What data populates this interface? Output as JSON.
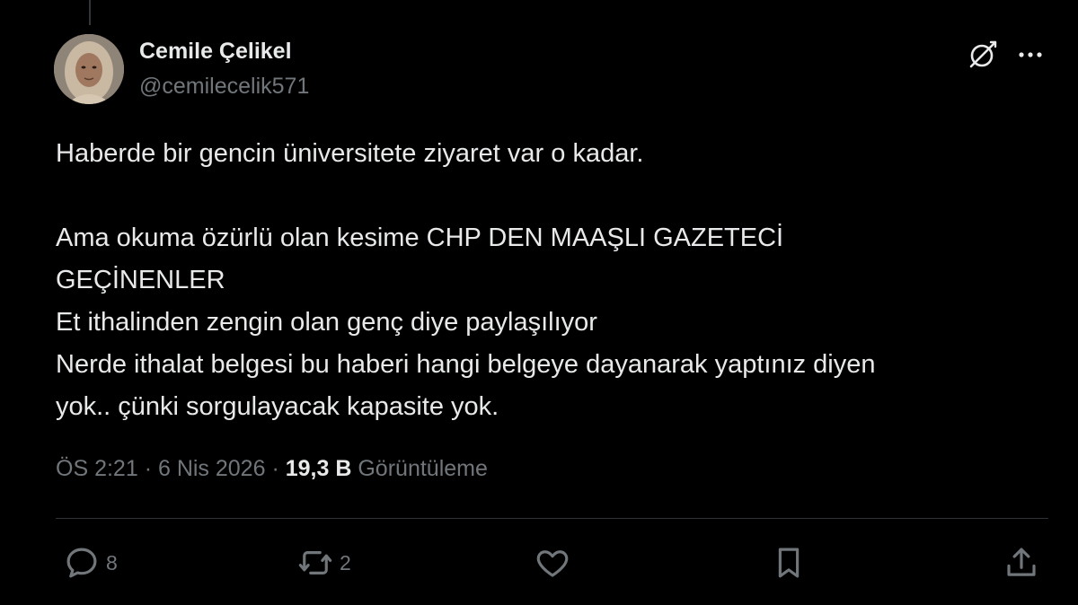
{
  "author": {
    "name": "Cemile Çelikel",
    "handle": "@cemilecelik571"
  },
  "tweet": {
    "lines_p1": [
      "Haberde bir gencin üniversitete ziyaret var o kadar."
    ],
    "lines_p2": [
      "Ama okuma özürlü olan kesime CHP DEN MAAŞLI GAZETECİ",
      "GEÇİNENLER",
      "Et ithalinden zengin olan genç diye paylaşılıyor",
      "Nerde ithalat belgesi bu haberi hangi belgeye dayanarak yaptınız diyen",
      "yok.. çünki  sorgulayacak kapasite yok."
    ]
  },
  "meta": {
    "time": "ÖS 2:21",
    "separator": "·",
    "date": "6 Nis 2026",
    "views_count": "19,3 B",
    "views_label": "Görüntüleme"
  },
  "actions": {
    "reply_count": "8",
    "retweet_count": "2"
  },
  "icons": {
    "thread": "thread-line",
    "grok": "grok-icon",
    "more": "more-dots-icon",
    "reply": "reply-bubble-icon",
    "retweet": "retweet-icon",
    "like": "heart-icon",
    "bookmark": "bookmark-icon",
    "share": "share-icon"
  },
  "colors": {
    "background": "#000000",
    "primary_text": "#e7e9ea",
    "secondary_text": "#71767b",
    "divider": "#2f3336"
  }
}
